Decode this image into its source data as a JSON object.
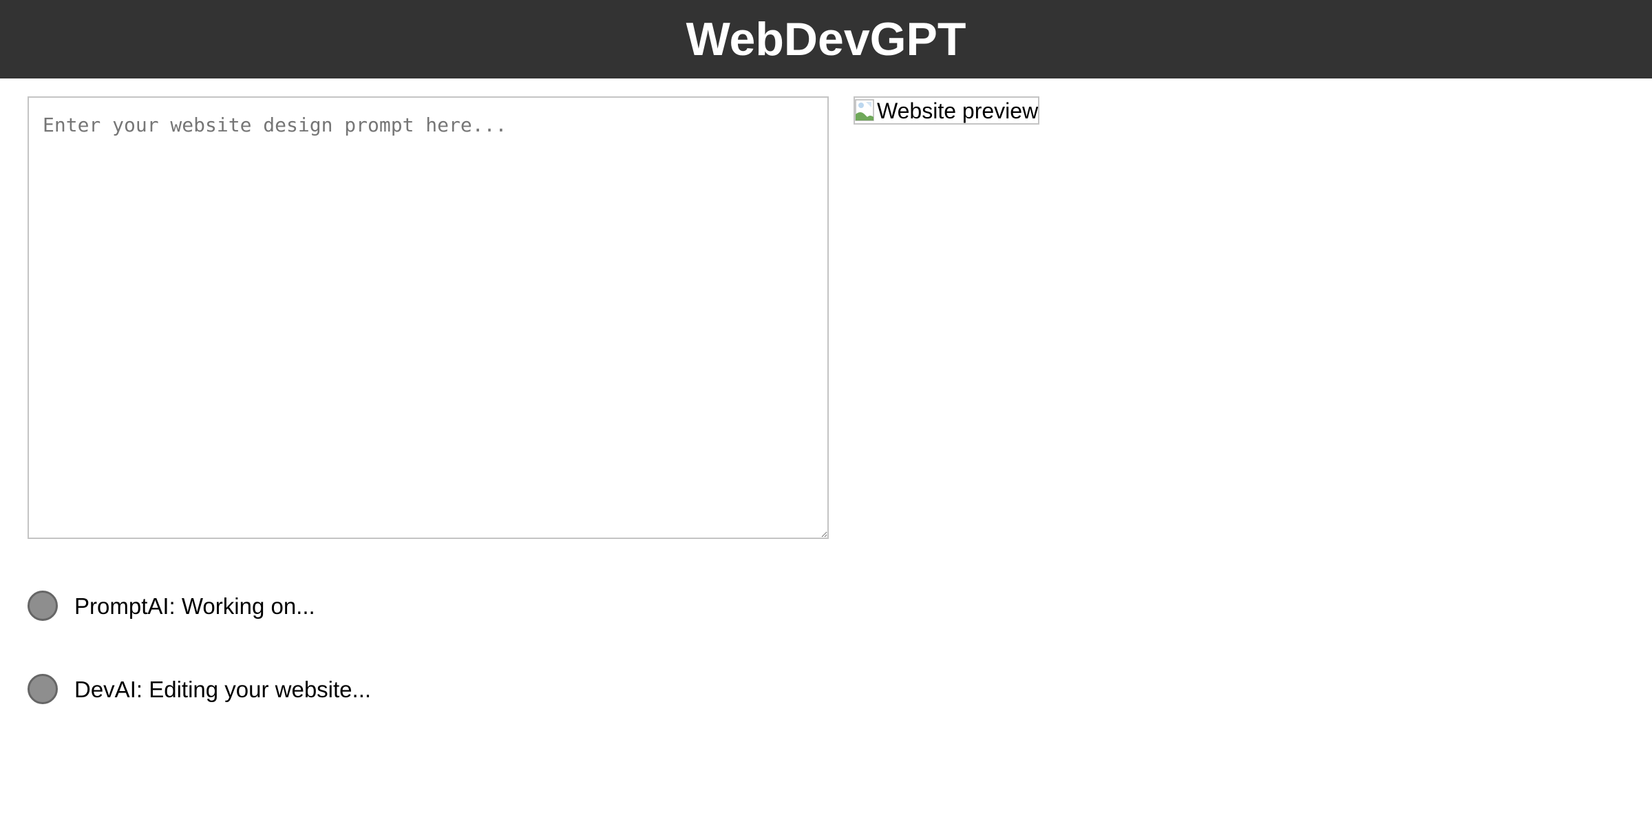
{
  "header": {
    "title": "WebDevGPT"
  },
  "prompt": {
    "value": "",
    "placeholder": "Enter your website design prompt here..."
  },
  "preview": {
    "alt_text": "Website preview",
    "icon": "broken-image-icon"
  },
  "status": [
    {
      "text": "PromptAI: Working on...",
      "indicator_color": "#8e8e8e"
    },
    {
      "text": "DevAI: Editing your website...",
      "indicator_color": "#8e8e8e"
    }
  ],
  "colors": {
    "header_background": "#333333",
    "header_text": "#ffffff",
    "border": "#c4c4c4",
    "indicator_border": "#666666"
  }
}
